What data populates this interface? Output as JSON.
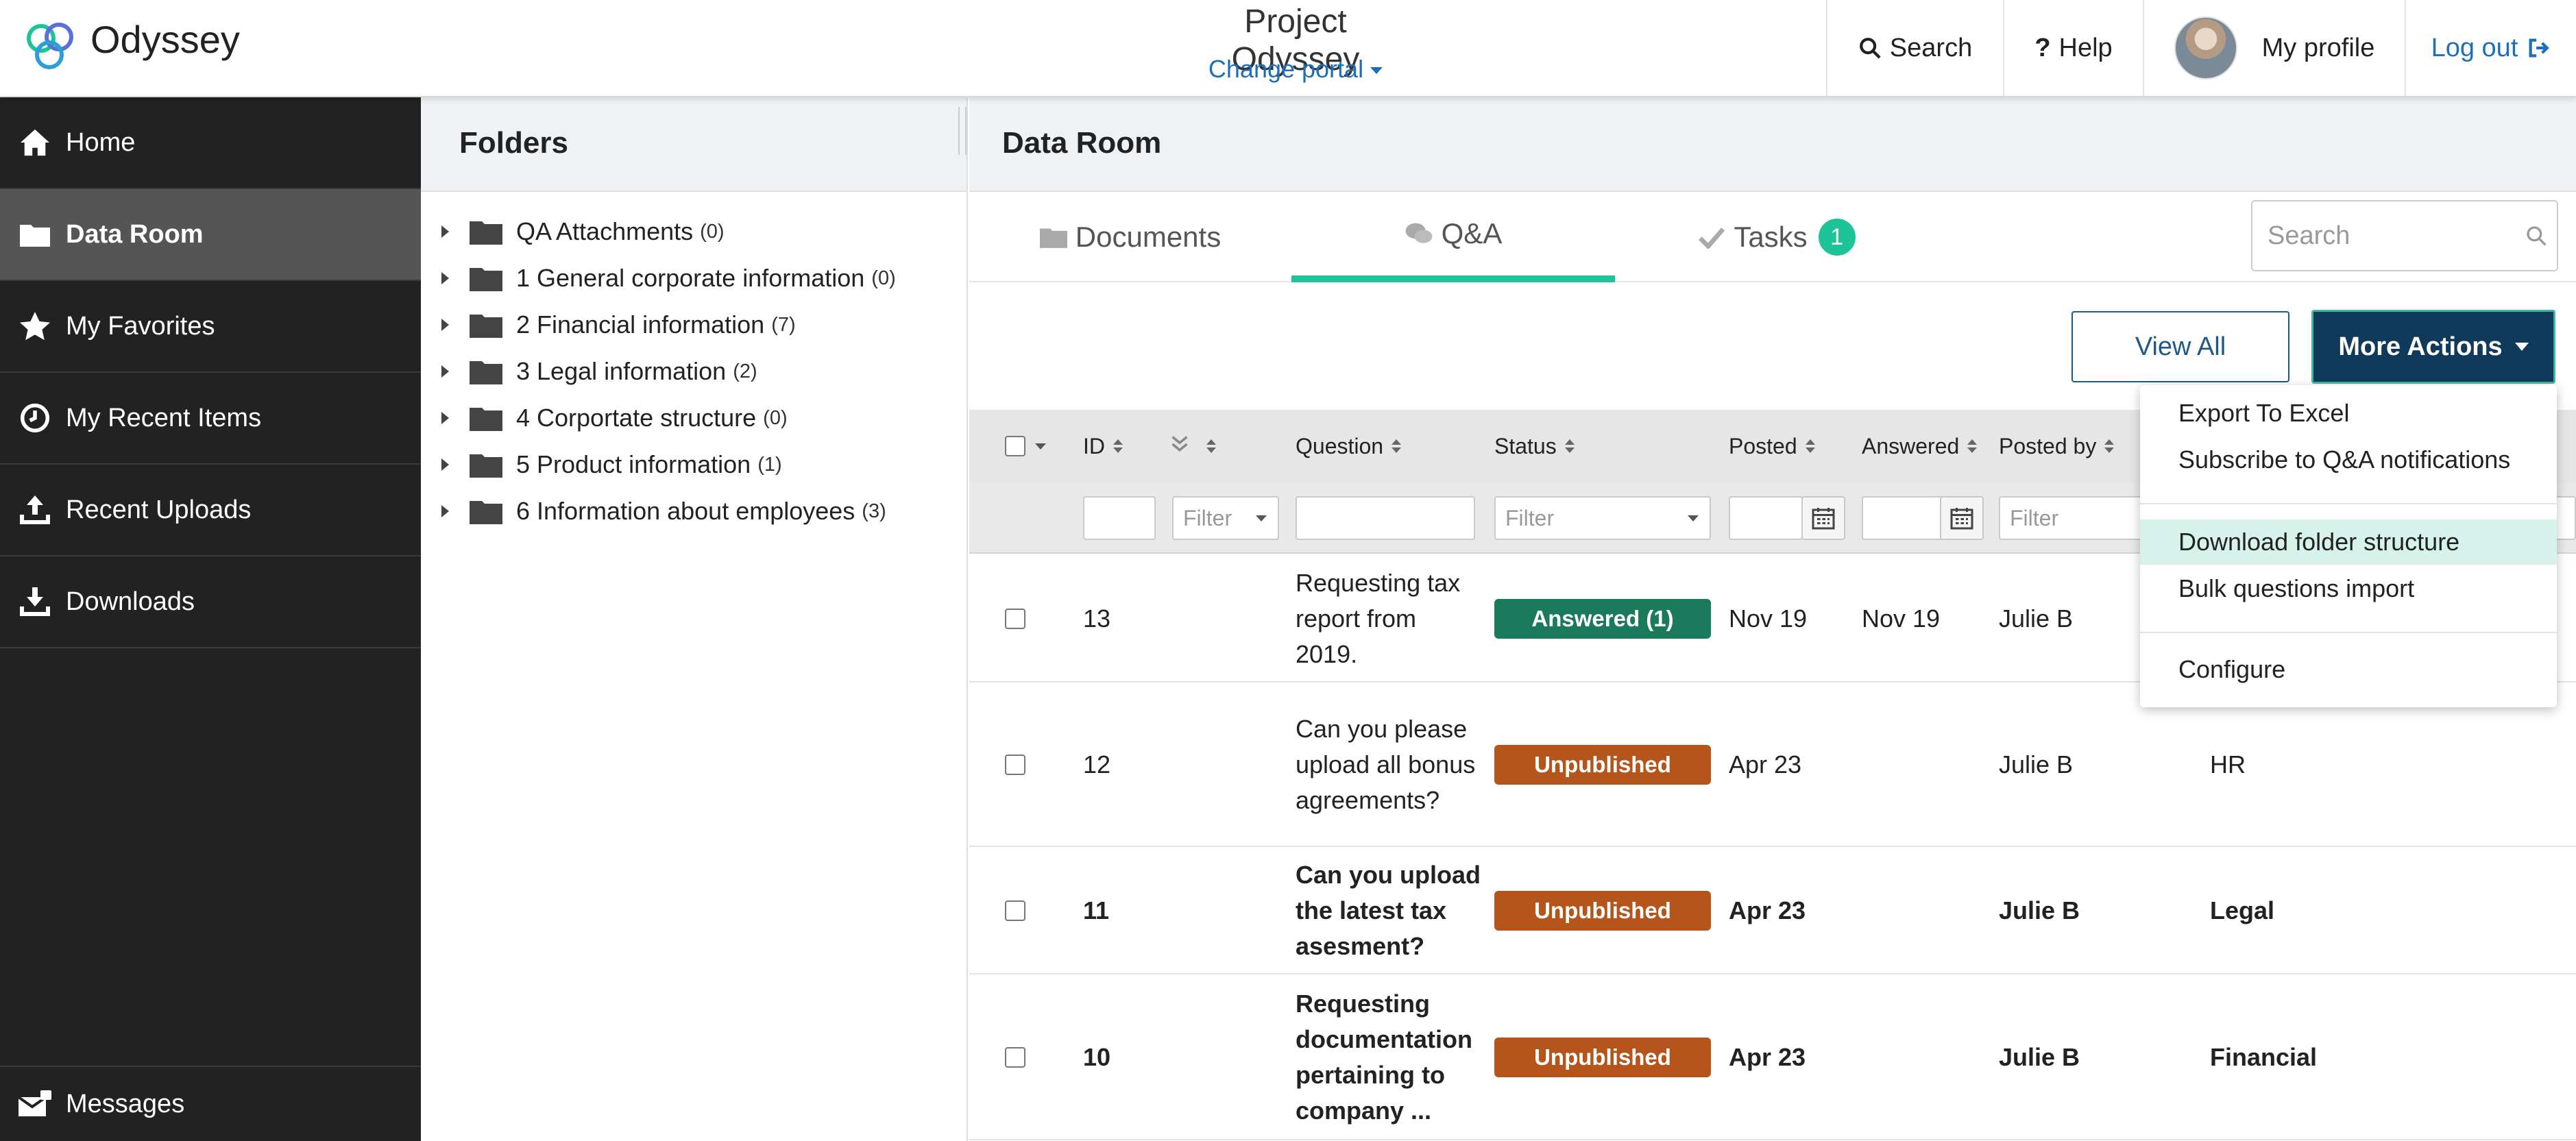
{
  "header": {
    "brand": "Odyssey",
    "project_title": "Project Odyssey",
    "change_portal": "Change portal",
    "nav": {
      "search": "Search",
      "help": "Help",
      "profile": "My profile",
      "logout": "Log out"
    }
  },
  "sidebar": {
    "items": [
      {
        "label": "Home",
        "icon": "home-icon"
      },
      {
        "label": "Data Room",
        "icon": "folder-icon",
        "active": true
      },
      {
        "label": "My Favorites",
        "icon": "star-icon"
      },
      {
        "label": "My Recent Items",
        "icon": "clock-icon"
      },
      {
        "label": "Recent Uploads",
        "icon": "upload-icon"
      },
      {
        "label": "Downloads",
        "icon": "download-icon"
      }
    ],
    "messages": "Messages"
  },
  "folders": {
    "title": "Folders",
    "items": [
      {
        "name": "QA Attachments",
        "count": "(0)"
      },
      {
        "name": "1 General corporate information",
        "count": "(0)"
      },
      {
        "name": "2 Financial information",
        "count": "(7)"
      },
      {
        "name": "3 Legal information",
        "count": "(2)"
      },
      {
        "name": "4 Corportate structure",
        "count": "(0)"
      },
      {
        "name": "5 Product information",
        "count": "(1)"
      },
      {
        "name": "6 Information about employees",
        "count": "(3)"
      }
    ]
  },
  "main": {
    "title": "Data Room",
    "tabs": {
      "documents": "Documents",
      "qa": "Q&A",
      "tasks": "Tasks",
      "tasks_badge": "1"
    },
    "search_placeholder": "Search",
    "view_all": "View All",
    "more_actions": "More Actions"
  },
  "table": {
    "columns": {
      "id": "ID",
      "question": "Question",
      "status": "Status",
      "posted": "Posted",
      "answered": "Answered",
      "posted_by": "Posted by"
    },
    "filter_placeholder": "Filter",
    "rows": [
      {
        "id": "13",
        "question": "Requesting tax report from 2019.",
        "status": "Answered (1)",
        "status_color": "#1b7a5c",
        "posted": "Nov 19",
        "answered": "Nov 19",
        "posted_by": "Julie B",
        "category": "",
        "bold": false
      },
      {
        "id": "12",
        "question": "Can you please upload all bonus agreements?",
        "status": "Unpublished",
        "status_color": "#b5541b",
        "posted": "Apr 23",
        "answered": "",
        "posted_by": "Julie B",
        "category": "HR",
        "bold": false
      },
      {
        "id": "11",
        "question": "Can you upload the latest tax asesment?",
        "status": "Unpublished",
        "status_color": "#b5541b",
        "posted": "Apr 23",
        "answered": "",
        "posted_by": "Julie B",
        "category": "Legal",
        "bold": true
      },
      {
        "id": "10",
        "question": "Requesting documentation pertaining to company ...",
        "status": "Unpublished",
        "status_color": "#b5541b",
        "posted": "Apr 23",
        "answered": "",
        "posted_by": "Julie B",
        "category": "Financial",
        "bold": true
      }
    ]
  },
  "more_actions_menu": {
    "items": [
      {
        "label": "Export To Excel"
      },
      {
        "label": "Subscribe to Q&A notifications"
      },
      {
        "label": "Download folder structure",
        "highlighted": true
      },
      {
        "label": "Bulk questions import"
      },
      {
        "label": "Configure"
      }
    ]
  },
  "colors": {
    "accent_teal": "#1fc398",
    "primary_navy": "#103a5c",
    "link_blue": "#1f6fb8",
    "sidebar_bg": "#222222"
  }
}
